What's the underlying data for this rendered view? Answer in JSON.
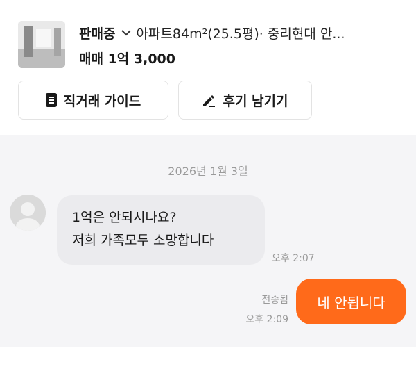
{
  "listing": {
    "status": "판매중",
    "title": "아파트84m²(25.5평)· 중리현대 안...",
    "price": "매매 1억 3,000"
  },
  "actions": {
    "guide_label": "직거래 가이드",
    "review_label": "후기 남기기"
  },
  "chat": {
    "date": "2026년 1월 3일",
    "incoming": {
      "lines": [
        "1억은 안되시나요?",
        "저희 가족모두 소망합니다"
      ],
      "time": "오후 2:07"
    },
    "outgoing": {
      "text": "네 안됩니다",
      "status": "전송됨",
      "time": "오후 2:09"
    }
  },
  "icons": {
    "status_dropdown": "chevron-down-icon",
    "guide": "document-icon",
    "review": "pencil-icon",
    "avatar": "user-icon",
    "thumbnail": "room-photo"
  },
  "colors": {
    "accent": "#ff6a1a",
    "chat_background": "#f5f5f7",
    "incoming_bubble": "#ebebee"
  }
}
